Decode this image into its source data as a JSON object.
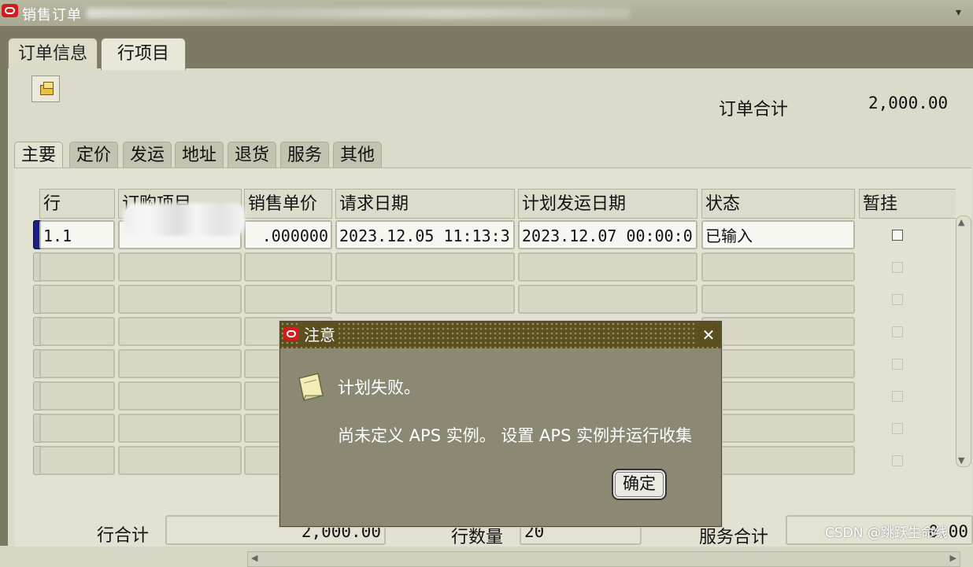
{
  "window": {
    "title": "销售订单"
  },
  "tabs": [
    {
      "label": "订单信息"
    },
    {
      "label": "行项目"
    }
  ],
  "order_total": {
    "label": "订单合计",
    "value": "2,000.00"
  },
  "subtabs": [
    {
      "label": "主要"
    },
    {
      "label": "定价"
    },
    {
      "label": "发运"
    },
    {
      "label": "地址"
    },
    {
      "label": "退货"
    },
    {
      "label": "服务"
    },
    {
      "label": "其他"
    }
  ],
  "table": {
    "columns": [
      "行",
      "订购项目",
      "销售单价",
      "请求日期",
      "计划发运日期",
      "状态",
      "暂挂"
    ],
    "rows": [
      [
        "1.1",
        "",
        ".000000",
        "2023.12.05 11:13:3",
        "2023.12.07 00:00:0",
        "已输入",
        ""
      ]
    ]
  },
  "footer": {
    "line_total_label": "行合计",
    "line_total_value": "2,000.00",
    "line_count_label": "行数量",
    "line_count_value": "20",
    "service_total_label": "服务合计",
    "service_total_value": "0.00"
  },
  "dialog": {
    "title": "注意",
    "message_line1": "计划失败。",
    "message_line2": "尚未定义 APS 实例。 设置 APS 实例并运行收集",
    "ok_label": "确定",
    "close_glyph": "✕"
  },
  "watermark": "CSDN @跳跃生命线"
}
